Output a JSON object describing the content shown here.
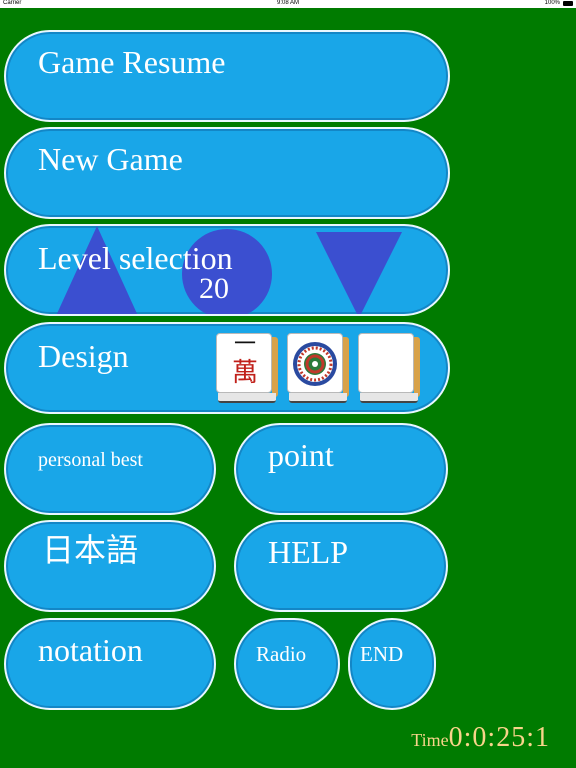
{
  "status_bar": {
    "carrier": "Carrier",
    "time": "9:08 AM",
    "battery": "100%"
  },
  "menu": {
    "game_resume": "Game Resume",
    "new_game": "New Game",
    "level_selection": "Level selection",
    "level_value": "20",
    "design": "Design",
    "personal_best": "personal best",
    "point": "point",
    "japanese": "日本語",
    "help": "HELP",
    "notation": "notation",
    "radio": "Radio",
    "end": "END"
  },
  "design_tiles": {
    "tile1_top": "一",
    "tile1_bottom": "萬"
  },
  "timer": {
    "label": "Time",
    "value": "0:0:25:1"
  },
  "colors": {
    "background": "#007b00",
    "button": "#19a6e8",
    "arrow": "#3b4fd0",
    "timer": "#f7d48a"
  }
}
